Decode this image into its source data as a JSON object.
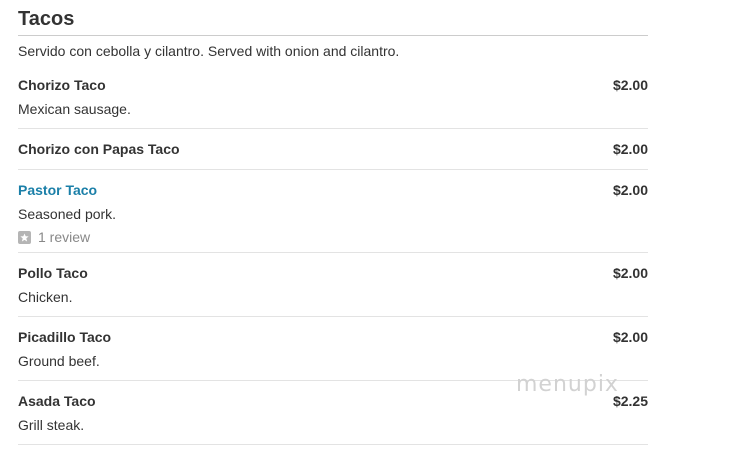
{
  "section": {
    "title": "Tacos",
    "description": "Servido con cebolla y cilantro. Served with onion and cilantro."
  },
  "items": [
    {
      "name": "Chorizo Taco",
      "price": "$2.00",
      "description": "Mexican sausage."
    },
    {
      "name": "Chorizo con Papas Taco",
      "price": "$2.00"
    },
    {
      "name": "Pastor Taco",
      "price": "$2.00",
      "description": "Seasoned pork.",
      "review": "1 review",
      "link_color": "#1a7fa8"
    },
    {
      "name": "Pollo Taco",
      "price": "$2.00",
      "description": "Chicken."
    },
    {
      "name": "Picadillo Taco",
      "price": "$2.00",
      "description": "Ground beef."
    },
    {
      "name": "Asada Taco",
      "price": "$2.25",
      "description": "Grill steak."
    }
  ],
  "watermark": "menupix",
  "icons": {
    "review": "star-icon"
  }
}
